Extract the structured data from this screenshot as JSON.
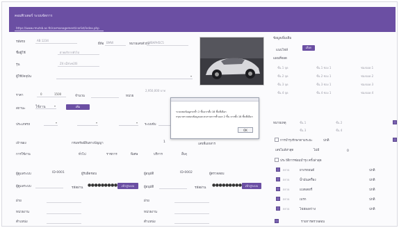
{
  "header": {
    "title": "คอมพิวเตอร์ ระบบจัดการ",
    "url": "https://www.rmutsb.ac.th/carmanagement/carlist/index.php"
  },
  "form": {
    "f1_label": "รหัสรถ",
    "f1_value": "AB 1234",
    "f2_label": "ยี่ห้อ",
    "f2_value": "BMW",
    "f3_label": "หมายเลขตัวถัง",
    "f3_value": "WBAPH5C5",
    "f4_label": "ชื่อผู้ใช้",
    "f4_value": "ฝ่ายบริการทั่วไป",
    "f5_label": "รุ่น",
    "f5_value": "Z4 sDrive20i",
    "f6_label": "ผู้ใช้ปัจจุบัน",
    "f6_value": "",
    "f7_label": "ราคา",
    "f7_a": "0",
    "f7_b": "1500",
    "f8_label": "จำนวน",
    "f8_value": "",
    "f9_label": "หน่วย",
    "f9_value": "2,950,000 บาท",
    "f10_label": "สถานะ",
    "f10_value": "ใช้งาน",
    "add_btn": "เพิ่ม"
  },
  "right_panel": {
    "heading": "ข้อมูลเพิ่มเติม",
    "upload_label": "แนบไฟล์",
    "upload_btn": "เลือก",
    "sub": "แผนที่จอด",
    "rows": [
      [
        "ชั้น 1 จุด",
        "ชั้น 1 ช่อง 1",
        "ช่องจอด 1"
      ],
      [
        "ชั้น 2 จุด",
        "ชั้น 2 ช่อง 1",
        "ช่องจอด 2"
      ],
      [
        "ชั้น 3 จุด",
        "ชั้น 3 ช่อง 1",
        "ช่องจอด 3"
      ],
      [
        "ชั้น 4 จุด",
        "ชั้น 4 ช่อง 1",
        "ช่องจอด 4"
      ]
    ]
  },
  "dialog": {
    "line1": "ระบบพบข้อมูลรถซ้ำ 2 ชิ้นจากทั้ง 18 ชิ้นที่เลือก",
    "line2": "กรุณาตรวจสอบข้อมูลและลบรายการซ้ำออก 2 ชิ้น จากทั้ง 18 ชิ้นที่เลือก",
    "ok": "OK"
  },
  "middle": {
    "type_label": "ประเภทรถ",
    "type_value": "",
    "type2_value": "",
    "type3_value": "",
    "mode_label": "ระบบขับ",
    "owner_label": "เจ้าของ",
    "owner_value": "กรมทรัพย์สินทางปัญญา",
    "owner_no": "1",
    "doc_label": "เลขที่เอกสาร",
    "doc_value": "",
    "use_label": "การใช้งาน",
    "use_cols": [
      "ทั่วไป",
      "ราชการ",
      "พิเศษ",
      "บริการ",
      "อื่นๆ"
    ]
  },
  "right_lower": {
    "r1_label": "หมายเหตุ",
    "r1_a": "ชั้น 1",
    "r1_b": "ชั้น 2",
    "r2_a": "ชั้น 3",
    "r2_b": "ชั้น 4",
    "r3_label": "การบำรุงรักษาตามระยะ",
    "r3_value": "ปกติ",
    "r4_label": "เลขไมล์ล่าสุด",
    "r4_value": "ไม่มี",
    "r4_b": "0",
    "r5_label": "ประวัติการซ่อมบำรุง ครั้งล่าสุด",
    "r5_value": "",
    "checks": [
      [
        "ตรวจ",
        "ยางรถยนต์",
        "ปกติ"
      ],
      [
        "ตรวจ",
        "น้ำมันเครื่อง",
        "ปกติ"
      ],
      [
        "ตรวจ",
        "แบตเตอรี่",
        "ปกติ"
      ],
      [
        "ตรวจ",
        "เบรก",
        "ปกติ"
      ],
      [
        "ตรวจ",
        "ไฟส่องสว่าง",
        "ปกติ"
      ]
    ],
    "last_label": "รายการตรวจสอบ"
  },
  "bottom": {
    "l1": "ผู้ดูแลระบบ",
    "l1_v": "",
    "l2": "ผู้รับผิดชอบ",
    "l2_v": "",
    "pwd_label": "รหัสผ่าน",
    "pwd_mask": "●●●●●●●●●●",
    "login_btn": "เข้าสู่ระบบ",
    "l3": "ฝ่าย",
    "l3_v": "",
    "l4": "หน่วยงาน",
    "l4_v": "",
    "l5": "ตำแหน่ง",
    "l5_v": "",
    "r1": "ผู้อนุมัติ",
    "r2": "ผู้ตรวจสอบ",
    "r3": "ฝ่าย",
    "r4": "หน่วยงาน",
    "r5": "ตำแหน่ง",
    "code1": "ID-0001",
    "code2": "ID-0002"
  }
}
